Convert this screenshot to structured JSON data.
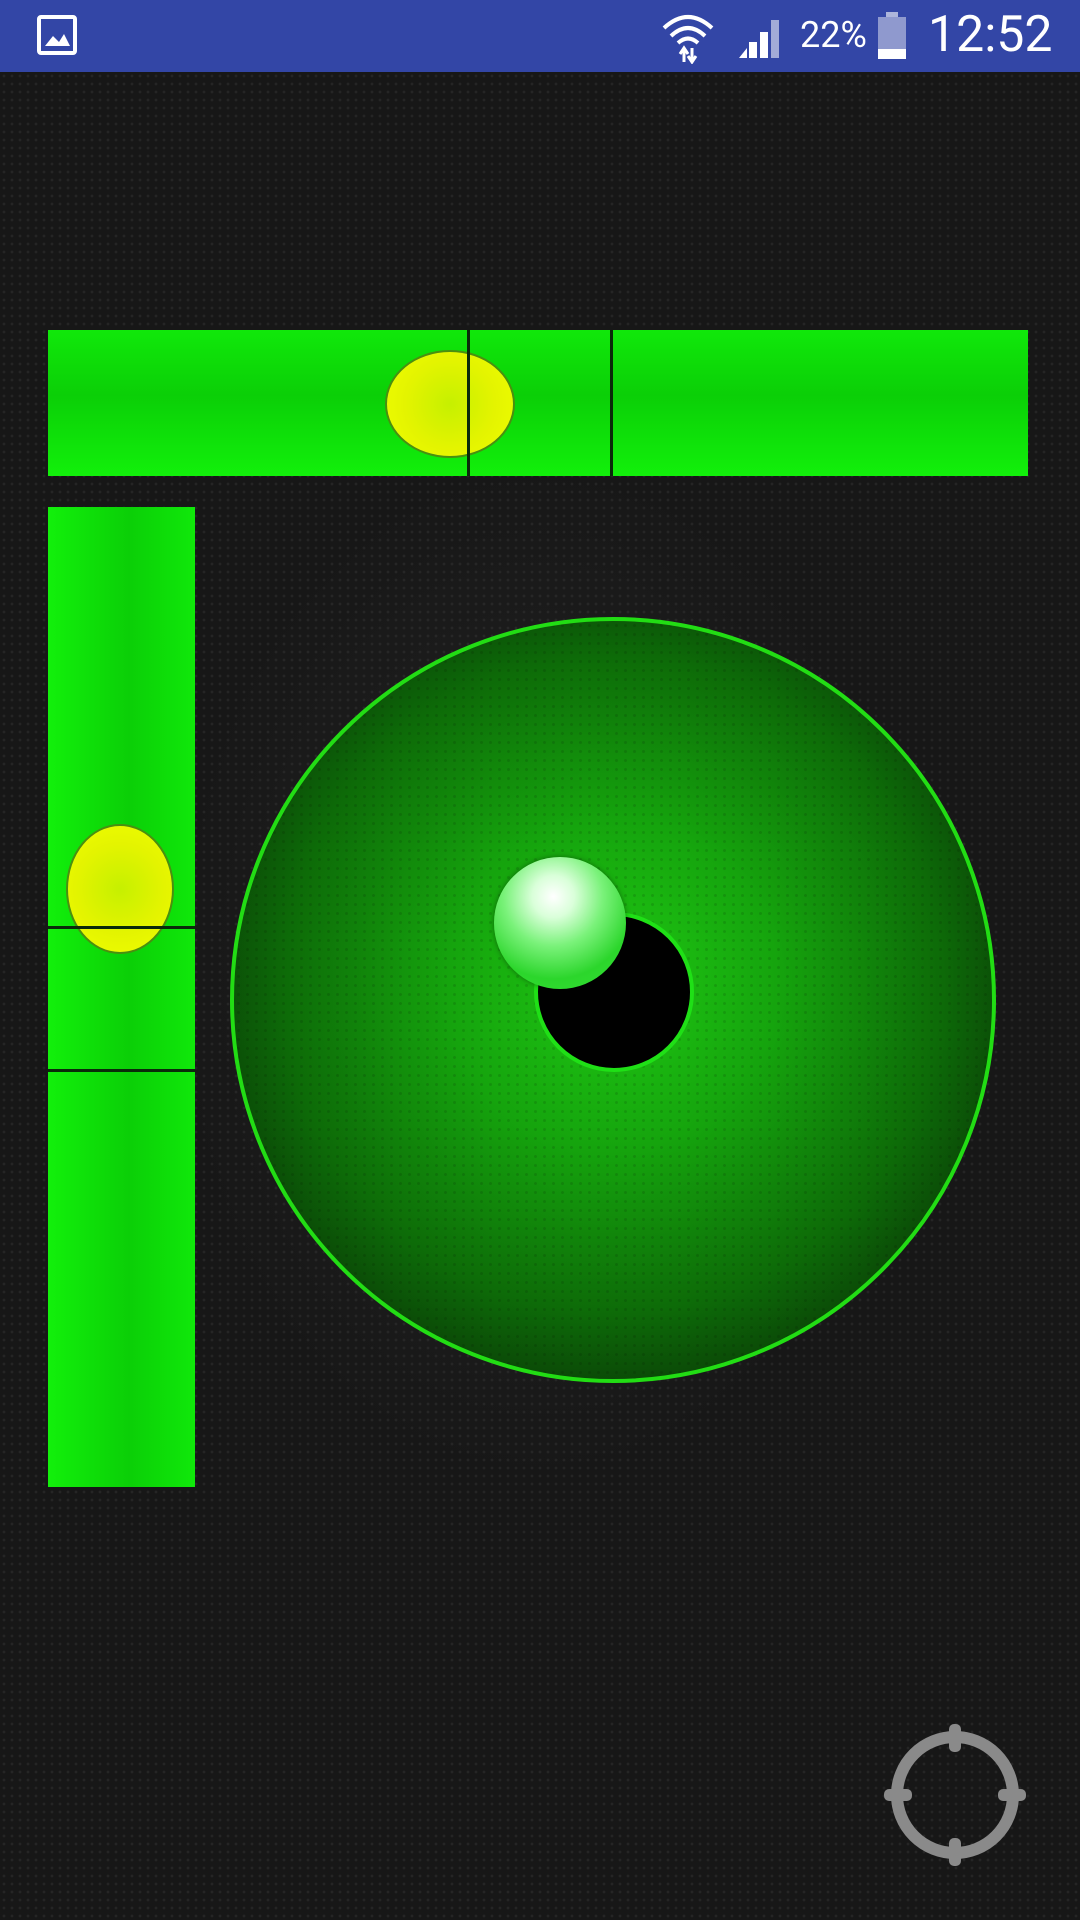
{
  "status_bar": {
    "battery_percent": "22%",
    "clock": "12:52",
    "icons": [
      "gallery-icon",
      "wifi-icon",
      "signal-icon",
      "battery-icon"
    ]
  },
  "level": {
    "horizontal_bubble_position": 0.41,
    "vertical_bubble_position": 0.39,
    "bullseye_ball_offset": {
      "dx": -0.14,
      "dy": -0.18
    },
    "accent_color": "#12f00b",
    "bubble_color": "#e8f600"
  },
  "controls": {
    "calibrate_icon": "crosshair-icon"
  }
}
